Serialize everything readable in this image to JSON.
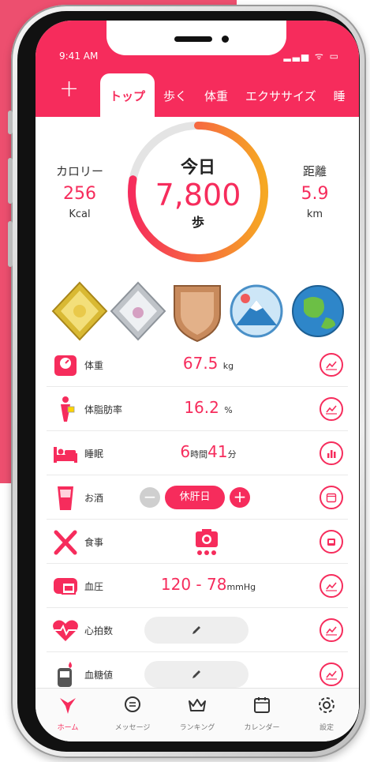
{
  "status_bar": {
    "time": "9:41 AM",
    "indicators": "▂▃▅ ᯤ ▭"
  },
  "header": {
    "add_label": "+",
    "tabs": [
      {
        "label": "トップ",
        "active": true
      },
      {
        "label": "歩く"
      },
      {
        "label": "体重"
      },
      {
        "label": "エクササイズ"
      },
      {
        "label": "睡"
      }
    ]
  },
  "summary": {
    "calories": {
      "label": "カロリー",
      "value": "256",
      "unit": "Kcal"
    },
    "today": {
      "label": "今日",
      "steps": "7,800",
      "unit": "歩"
    },
    "distance": {
      "label": "距離",
      "value": "5.9",
      "unit": "km"
    },
    "progress_fraction": 0.78
  },
  "medals": [
    "gold-medal",
    "silver-medal",
    "bronze-shield",
    "mountain-badge",
    "earth-badge"
  ],
  "rows": {
    "weight": {
      "label": "体重",
      "value": "67.5",
      "unit": "kg"
    },
    "body_fat": {
      "label": "体脂肪率",
      "value": "16.2",
      "unit": "%"
    },
    "sleep": {
      "label": "睡眠",
      "hours": "6",
      "hours_unit": "時間",
      "minutes": "41",
      "minutes_unit": "分"
    },
    "alcohol": {
      "label": "お酒",
      "minus": "−",
      "status": "休肝日",
      "plus": "+"
    },
    "meal": {
      "label": "食事"
    },
    "blood_pressure": {
      "label": "血圧",
      "value": "120 - 78",
      "unit": "mmHg"
    },
    "heart_rate": {
      "label": "心拍数"
    },
    "blood_sugar": {
      "label": "血糖値"
    }
  },
  "tabbar": [
    {
      "label": "ホーム",
      "icon": "home-icon",
      "active": true
    },
    {
      "label": "メッセージ",
      "icon": "message-icon"
    },
    {
      "label": "ランキング",
      "icon": "crown-icon"
    },
    {
      "label": "カレンダー",
      "icon": "calendar-icon"
    },
    {
      "label": "設定",
      "icon": "gear-icon"
    }
  ],
  "colors": {
    "accent": "#f62c5c",
    "ring_gradient_end": "#f6a823",
    "background_panel": "#ed4f6f"
  }
}
